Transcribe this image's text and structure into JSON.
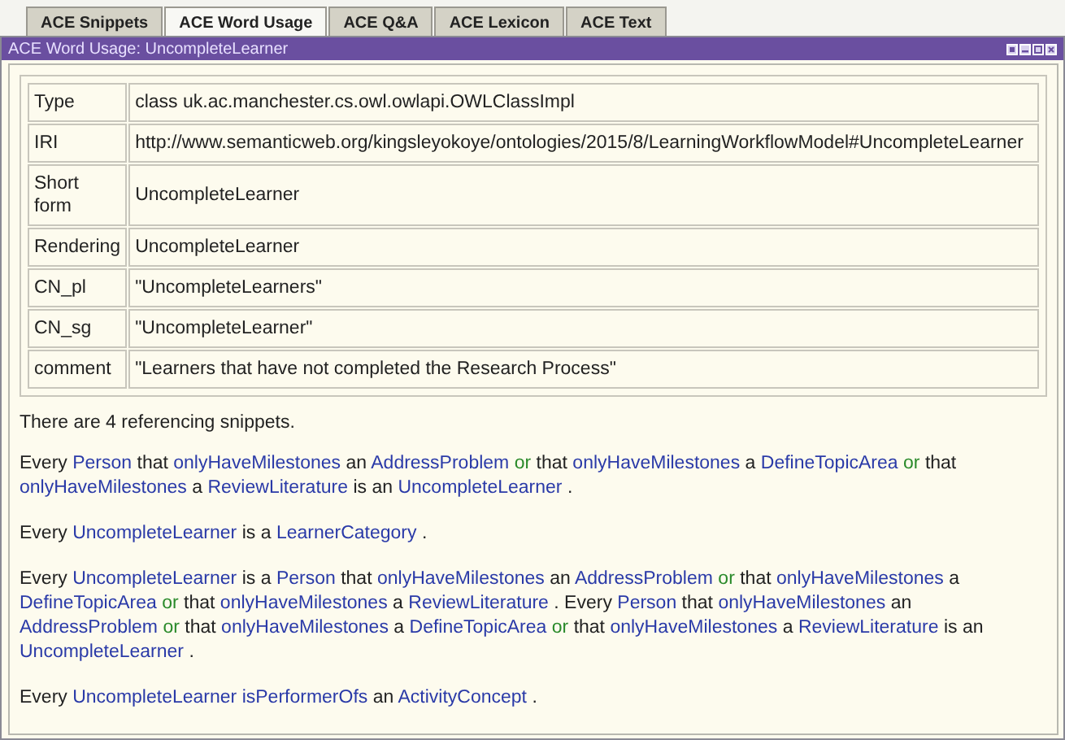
{
  "tabs": [
    {
      "label": "ACE Snippets",
      "selected": false
    },
    {
      "label": "ACE Word Usage",
      "selected": true
    },
    {
      "label": "ACE Q&A",
      "selected": false
    },
    {
      "label": "ACE Lexicon",
      "selected": false
    },
    {
      "label": "ACE Text",
      "selected": false
    }
  ],
  "panel": {
    "title": "ACE Word Usage: UncompleteLearner"
  },
  "properties": [
    {
      "key": "Type",
      "value": "class uk.ac.manchester.cs.owl.owlapi.OWLClassImpl"
    },
    {
      "key": "IRI",
      "value": "http://www.semanticweb.org/kingsleyokoye/ontologies/2015/8/LearningWorkflowModel#UncompleteLearner"
    },
    {
      "key": "Short form",
      "value": "UncompleteLearner"
    },
    {
      "key": "Rendering",
      "value": "UncompleteLearner"
    },
    {
      "key": "CN_pl",
      "value": "\"UncompleteLearners\""
    },
    {
      "key": "CN_sg",
      "value": "\"UncompleteLearner\""
    },
    {
      "key": "comment",
      "value": "\"Learners that have not completed the Research Process\""
    }
  ],
  "summary": "There are 4 referencing snippets.",
  "snippets": [
    [
      {
        "text": "Every",
        "kind": "plain"
      },
      {
        "text": "Person",
        "kind": "name"
      },
      {
        "text": "that",
        "kind": "plain"
      },
      {
        "text": "onlyHaveMilestones",
        "kind": "name"
      },
      {
        "text": "an",
        "kind": "plain"
      },
      {
        "text": "AddressProblem",
        "kind": "name"
      },
      {
        "text": "or",
        "kind": "connective"
      },
      {
        "text": "that",
        "kind": "plain"
      },
      {
        "text": "onlyHaveMilestones",
        "kind": "name"
      },
      {
        "text": "a",
        "kind": "plain"
      },
      {
        "text": "DefineTopicArea",
        "kind": "name"
      },
      {
        "text": "or",
        "kind": "connective"
      },
      {
        "text": "that",
        "kind": "plain"
      },
      {
        "text": "onlyHaveMilestones",
        "kind": "name"
      },
      {
        "text": "a",
        "kind": "plain"
      },
      {
        "text": "ReviewLiterature",
        "kind": "name"
      },
      {
        "text": "is an",
        "kind": "plain"
      },
      {
        "text": "UncompleteLearner",
        "kind": "name"
      },
      {
        "text": ".",
        "kind": "plain"
      }
    ],
    [
      {
        "text": "Every",
        "kind": "plain"
      },
      {
        "text": "UncompleteLearner",
        "kind": "name"
      },
      {
        "text": "is a",
        "kind": "plain"
      },
      {
        "text": "LearnerCategory",
        "kind": "name"
      },
      {
        "text": ".",
        "kind": "plain"
      }
    ],
    [
      {
        "text": "Every",
        "kind": "plain"
      },
      {
        "text": "UncompleteLearner",
        "kind": "name"
      },
      {
        "text": "is a",
        "kind": "plain"
      },
      {
        "text": "Person",
        "kind": "name"
      },
      {
        "text": "that",
        "kind": "plain"
      },
      {
        "text": "onlyHaveMilestones",
        "kind": "name"
      },
      {
        "text": "an",
        "kind": "plain"
      },
      {
        "text": "AddressProblem",
        "kind": "name"
      },
      {
        "text": "or",
        "kind": "connective"
      },
      {
        "text": "that",
        "kind": "plain"
      },
      {
        "text": "onlyHaveMilestones",
        "kind": "name"
      },
      {
        "text": "a",
        "kind": "plain"
      },
      {
        "text": "DefineTopicArea",
        "kind": "name"
      },
      {
        "text": "or",
        "kind": "connective"
      },
      {
        "text": "that",
        "kind": "plain"
      },
      {
        "text": "onlyHaveMilestones",
        "kind": "name"
      },
      {
        "text": "a",
        "kind": "plain"
      },
      {
        "text": "ReviewLiterature",
        "kind": "name"
      },
      {
        "text": ". Every",
        "kind": "plain"
      },
      {
        "text": "Person",
        "kind": "name"
      },
      {
        "text": "that",
        "kind": "plain"
      },
      {
        "text": "onlyHaveMilestones",
        "kind": "name"
      },
      {
        "text": "an",
        "kind": "plain"
      },
      {
        "text": "AddressProblem",
        "kind": "name"
      },
      {
        "text": "or",
        "kind": "connective"
      },
      {
        "text": "that",
        "kind": "plain"
      },
      {
        "text": "onlyHaveMilestones",
        "kind": "name"
      },
      {
        "text": "a",
        "kind": "plain"
      },
      {
        "text": "DefineTopicArea",
        "kind": "name"
      },
      {
        "text": "or",
        "kind": "connective"
      },
      {
        "text": "that",
        "kind": "plain"
      },
      {
        "text": "onlyHaveMilestones",
        "kind": "name"
      },
      {
        "text": "a",
        "kind": "plain"
      },
      {
        "text": "ReviewLiterature",
        "kind": "name"
      },
      {
        "text": "is an",
        "kind": "plain"
      },
      {
        "text": "UncompleteLearner",
        "kind": "name"
      },
      {
        "text": ".",
        "kind": "plain"
      }
    ],
    [
      {
        "text": "Every",
        "kind": "plain"
      },
      {
        "text": "UncompleteLearner",
        "kind": "name"
      },
      {
        "text": "isPerformerOfs",
        "kind": "name"
      },
      {
        "text": "an",
        "kind": "plain"
      },
      {
        "text": "ActivityConcept",
        "kind": "name"
      },
      {
        "text": ".",
        "kind": "plain"
      }
    ]
  ]
}
